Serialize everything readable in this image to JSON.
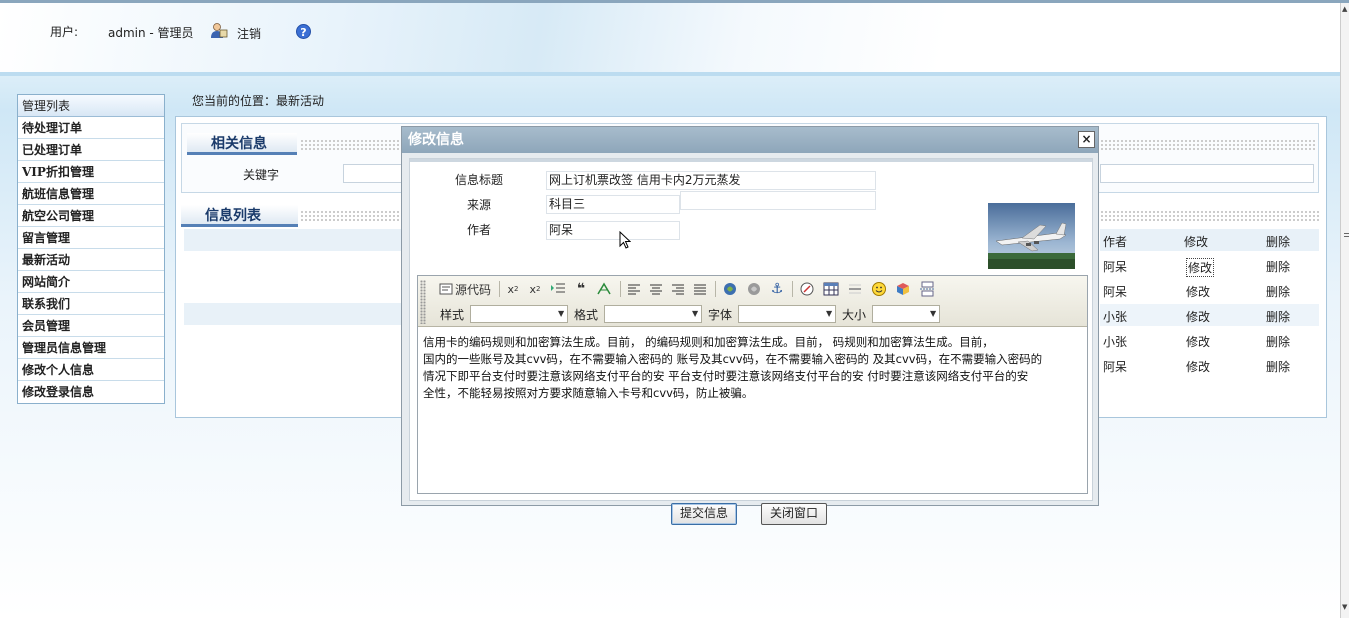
{
  "header": {
    "user_label": "用户:",
    "user_value": "admin - 管理员",
    "logout": "注销",
    "help_glyph": "?"
  },
  "sidebar": {
    "title": "管理列表",
    "items": [
      "待处理订单",
      "已处理订单",
      "VIP折扣管理",
      "航班信息管理",
      "航空公司管理",
      "留言管理",
      "最新活动",
      "网站简介",
      "联系我们",
      "会员管理",
      "管理员信息管理",
      "修改个人信息",
      "修改登录信息"
    ]
  },
  "breadcrumb": "您当前的位置：最新活动",
  "related_section": {
    "title": "相关信息",
    "keyword_label": "关键字"
  },
  "list_section": {
    "title": "信息列表",
    "columns": {
      "author": "作者",
      "edit": "修改",
      "delete": "删除"
    },
    "rows": [
      {
        "author": "阿呆",
        "edit": "修改",
        "delete": "删除"
      },
      {
        "author": "阿呆",
        "edit": "修改",
        "delete": "删除"
      },
      {
        "author": "小张",
        "edit": "修改",
        "delete": "删除"
      },
      {
        "author": "小张",
        "edit": "修改",
        "delete": "删除"
      },
      {
        "author": "阿呆",
        "edit": "修改",
        "delete": "删除"
      }
    ]
  },
  "modal": {
    "title": "修改信息",
    "close_glyph": "×",
    "fields": {
      "title_label": "信息标题",
      "title_value": "网上订机票改签 信用卡内2万元蒸发",
      "source_label": "来源",
      "source_value": "科目三",
      "author_label": "作者",
      "author_value": "阿呆"
    },
    "toolbar": {
      "source_code": "源代码",
      "style_label": "样式",
      "format_label": "格式",
      "font_label": "字体",
      "size_label": "大小"
    },
    "content_lines": [
      "    信用卡的编码规则和加密算法生成。目前，          的编码规则和加密算法生成。目前，          码规则和加密算法生成。目前，",
      "国内的一些账号及其cvv码，在不需要输入密码的  账号及其cvv码，在不需要输入密码的  及其cvv码，在不需要输入密码的",
      "情况下即平台支付时要注意该网络支付平台的安  平台支付时要注意该网络支付平台的安  付时要注意该网络支付平台的安",
      "全性，不能轻易按照对方要求随意输入卡号和cvv码，防止被骗。"
    ],
    "submit_button": "提交信息",
    "close_button": "关闭窗口"
  },
  "colors": {
    "accent": "#5580b6",
    "modal_title_bar": "#8ea6ba",
    "sidebar_border": "#8ab0cc"
  },
  "icons": [
    "user-icon",
    "help-icon",
    "close-icon",
    "subscript-icon",
    "superscript-icon",
    "indent-icon",
    "quote-icon",
    "align-left-icon",
    "align-center-icon",
    "align-right-icon",
    "justify-icon",
    "link-icon",
    "unlink-icon",
    "anchor-icon",
    "flash-icon",
    "table-icon",
    "hr-icon",
    "smiley-icon",
    "special-char-icon",
    "pagebreak-icon"
  ]
}
